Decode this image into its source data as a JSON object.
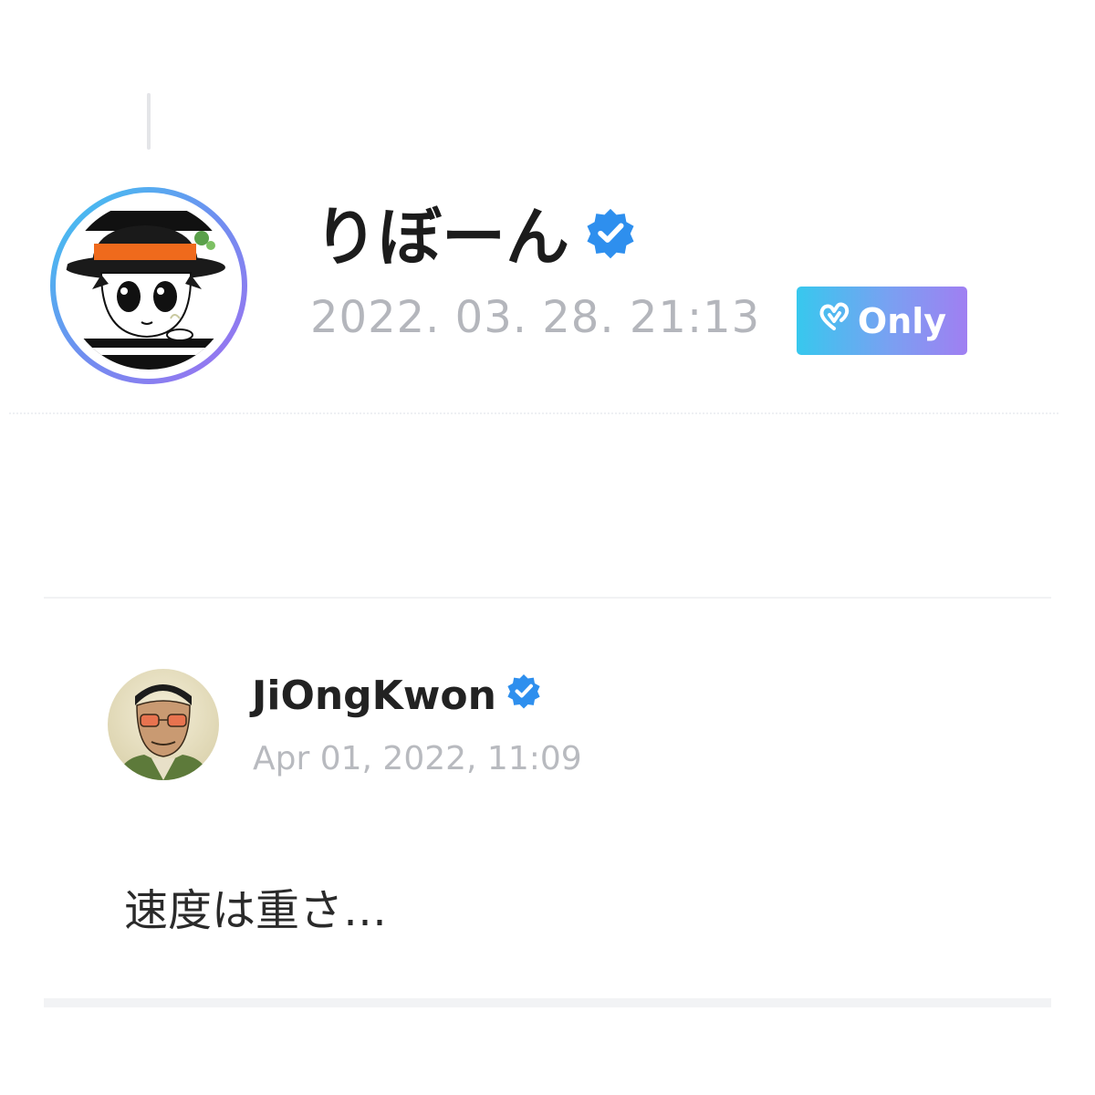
{
  "post": {
    "author_name": "りぼーん",
    "verified": true,
    "date": "2022. 03. 28. 21:13",
    "badge_label": "Only",
    "badge_icon": "heart-v-icon",
    "avatar_ring_colors": [
      "#3cc8f0",
      "#a06ff0"
    ]
  },
  "comment": {
    "author_name": "JiOngKwon",
    "verified": true,
    "date": "Apr 01, 2022, 11:09",
    "text": "速度は重さ…"
  },
  "colors": {
    "verified_badge": "#2e8fee",
    "date_text": "#b4b6bc",
    "badge_gradient_start": "#37c8ee",
    "badge_gradient_end": "#a07ff2"
  }
}
